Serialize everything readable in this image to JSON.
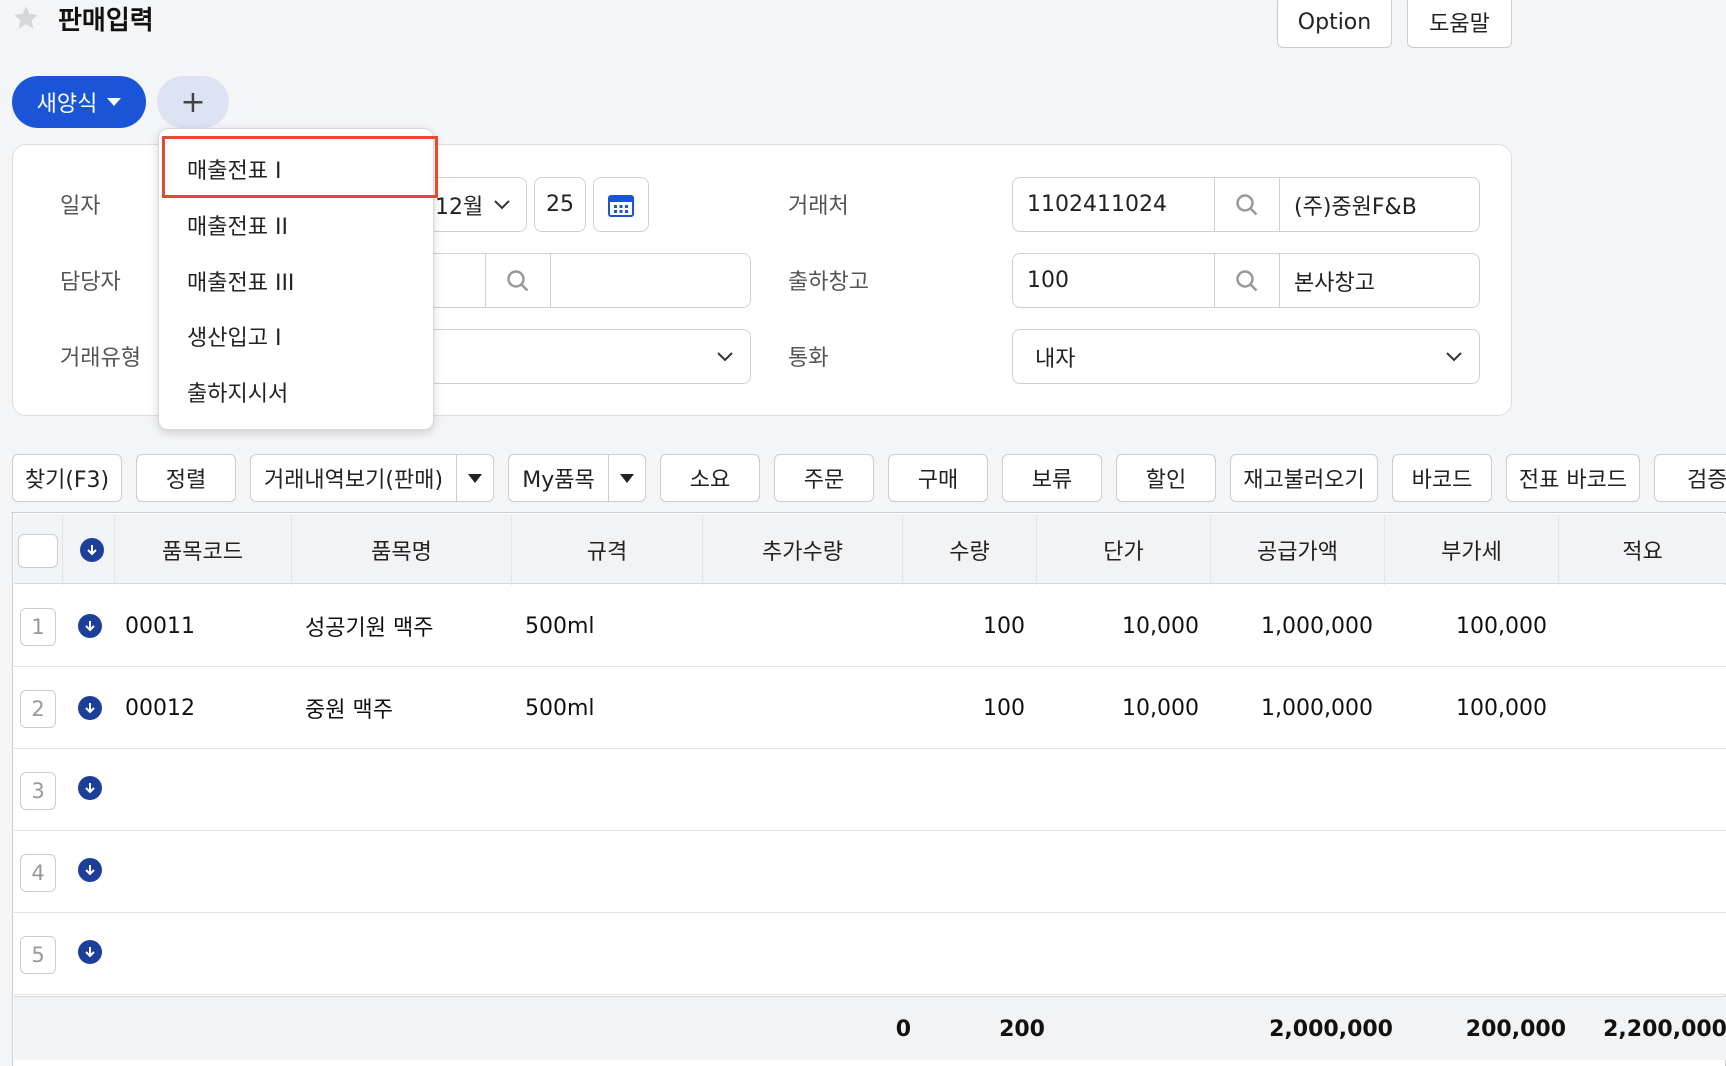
{
  "header": {
    "title": "판매입력",
    "option_label": "Option",
    "help_label": "도움말"
  },
  "tabs": {
    "new_form_label": "새양식",
    "add_label": "+"
  },
  "dropdown_menu": {
    "items": [
      "매출전표 I",
      "매출전표 II",
      "매출전표 III",
      "생산입고 I",
      "출하지시서"
    ],
    "selected_index": 0
  },
  "form": {
    "date_label": "일자",
    "date_month": "12월",
    "date_day": "25",
    "manager_label": "담당자",
    "trade_type_label": "거래유형",
    "client_label": "거래처",
    "client_code": "1102411024",
    "client_name": "(주)중원F&B",
    "warehouse_label": "출하창고",
    "warehouse_code": "100",
    "warehouse_name": "본사창고",
    "currency_label": "통화",
    "currency_value": "내자"
  },
  "toolbar": {
    "find": "찾기(F3)",
    "sort": "정렬",
    "history": "거래내역보기(판매)",
    "my_items": "My품목",
    "consume": "소요",
    "order": "주문",
    "purchase": "구매",
    "hold": "보류",
    "discount": "할인",
    "load_stock": "재고불러오기",
    "barcode": "바코드",
    "slip_barcode": "전표 바코드",
    "verify": "검증"
  },
  "grid": {
    "columns": [
      "품목코드",
      "품목명",
      "규격",
      "추가수량",
      "수량",
      "단가",
      "공급가액",
      "부가세",
      "적요"
    ],
    "rows": [
      {
        "no": "1",
        "code": "00011",
        "name": "성공기원 맥주",
        "spec": "500ml",
        "extra": "",
        "qty": "100",
        "price": "10,000",
        "supply": "1,000,000",
        "vat": "100,000",
        "memo": ""
      },
      {
        "no": "2",
        "code": "00012",
        "name": "중원 맥주",
        "spec": "500ml",
        "extra": "",
        "qty": "100",
        "price": "10,000",
        "supply": "1,000,000",
        "vat": "100,000",
        "memo": ""
      },
      {
        "no": "3",
        "code": "",
        "name": "",
        "spec": "",
        "extra": "",
        "qty": "",
        "price": "",
        "supply": "",
        "vat": "",
        "memo": ""
      },
      {
        "no": "4",
        "code": "",
        "name": "",
        "spec": "",
        "extra": "",
        "qty": "",
        "price": "",
        "supply": "",
        "vat": "",
        "memo": ""
      },
      {
        "no": "5",
        "code": "",
        "name": "",
        "spec": "",
        "extra": "",
        "qty": "",
        "price": "",
        "supply": "",
        "vat": "",
        "memo": ""
      }
    ],
    "footer": {
      "extra_total": "0",
      "qty_total": "200",
      "supply_total": "2,000,000",
      "vat_total": "200,000",
      "grand_total": "2,200,000"
    }
  },
  "colors": {
    "primary": "#1a55d8",
    "highlight": "#e5492f",
    "icon_navy": "#1d3f9a"
  }
}
